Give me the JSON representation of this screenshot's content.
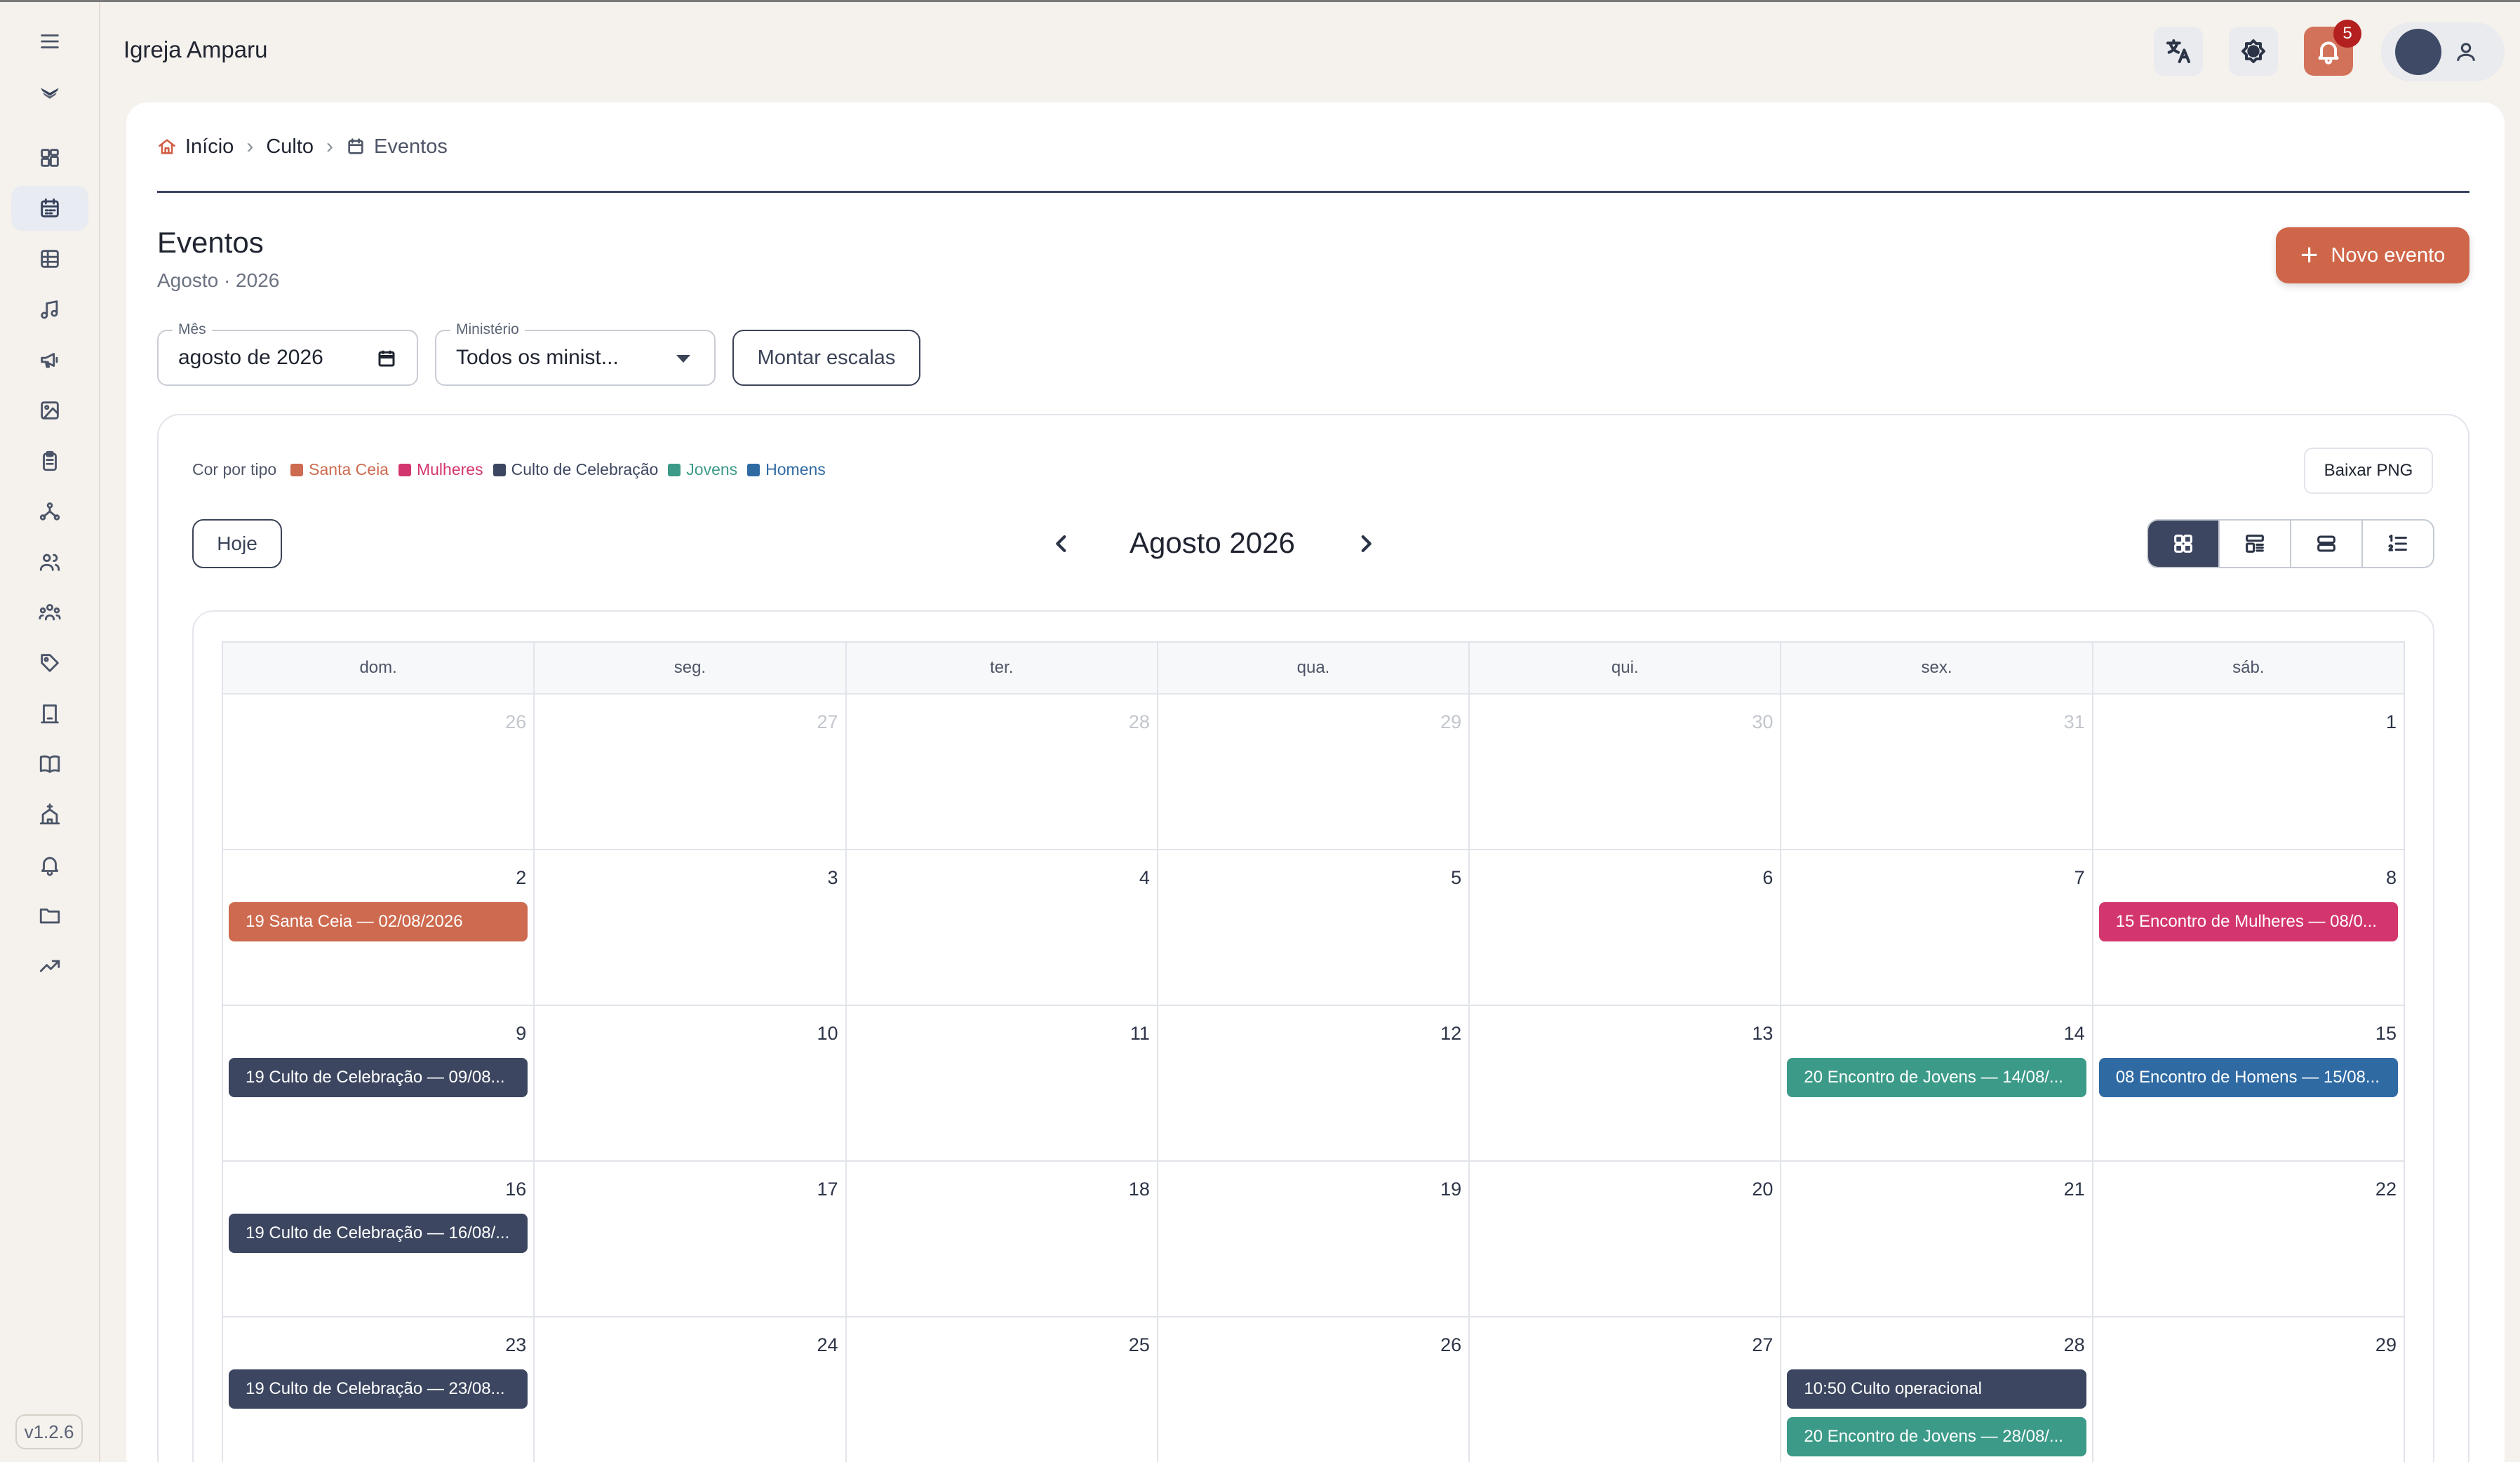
{
  "app": {
    "title": "Igreja Amparu",
    "version": "v1.2.6"
  },
  "topbar": {
    "translate_icon": "translate-icon",
    "theme_icon": "brightness-icon",
    "notifications_count": "5"
  },
  "breadcrumb": {
    "home": "Início",
    "section": "Culto",
    "current": "Eventos"
  },
  "page": {
    "title": "Eventos",
    "subtitle": "Agosto · 2026",
    "new_event_label": "Novo evento"
  },
  "filters": {
    "month_label": "Mês",
    "month_value": "agosto de 2026",
    "ministry_label": "Ministério",
    "ministry_value": "Todos os minist...",
    "build_scales_label": "Montar escalas"
  },
  "legend": {
    "title": "Cor por tipo",
    "items": [
      {
        "label": "Santa Ceia",
        "color": "#cd6a4f"
      },
      {
        "label": "Mulheres",
        "color": "#d3366e"
      },
      {
        "label": "Culto de Celebração",
        "color": "#3c4660"
      },
      {
        "label": "Jovens",
        "color": "#3c9a88"
      },
      {
        "label": "Homens",
        "color": "#2f6aa3"
      }
    ]
  },
  "calendar": {
    "download_label": "Baixar PNG",
    "today_label": "Hoje",
    "month_title": "Agosto 2026",
    "weekdays": [
      "dom.",
      "seg.",
      "ter.",
      "qua.",
      "qui.",
      "sex.",
      "sáb."
    ],
    "weeks": [
      [
        {
          "d": "26",
          "o": true
        },
        {
          "d": "27",
          "o": true
        },
        {
          "d": "28",
          "o": true
        },
        {
          "d": "29",
          "o": true
        },
        {
          "d": "30",
          "o": true
        },
        {
          "d": "31",
          "o": true
        },
        {
          "d": "1"
        }
      ],
      [
        {
          "d": "2",
          "e": [
            {
              "t": "19 Santa Ceia — 02/08/2026",
              "c": "#cd6a4f"
            }
          ]
        },
        {
          "d": "3"
        },
        {
          "d": "4"
        },
        {
          "d": "5"
        },
        {
          "d": "6"
        },
        {
          "d": "7"
        },
        {
          "d": "8",
          "e": [
            {
              "t": "15 Encontro de Mulheres — 08/0...",
              "c": "#d3366e"
            }
          ]
        }
      ],
      [
        {
          "d": "9",
          "e": [
            {
              "t": "19 Culto de Celebração — 09/08...",
              "c": "#3c4660"
            }
          ]
        },
        {
          "d": "10"
        },
        {
          "d": "11"
        },
        {
          "d": "12"
        },
        {
          "d": "13"
        },
        {
          "d": "14",
          "e": [
            {
              "t": "20 Encontro de Jovens — 14/08/...",
              "c": "#3c9a88"
            }
          ]
        },
        {
          "d": "15",
          "e": [
            {
              "t": "08 Encontro de Homens — 15/08...",
              "c": "#2f6aa3"
            }
          ]
        }
      ],
      [
        {
          "d": "16",
          "e": [
            {
              "t": "19 Culto de Celebração — 16/08/...",
              "c": "#3c4660"
            }
          ]
        },
        {
          "d": "17"
        },
        {
          "d": "18"
        },
        {
          "d": "19"
        },
        {
          "d": "20"
        },
        {
          "d": "21"
        },
        {
          "d": "22"
        }
      ],
      [
        {
          "d": "23",
          "e": [
            {
              "t": "19 Culto de Celebração — 23/08...",
              "c": "#3c4660"
            }
          ]
        },
        {
          "d": "24"
        },
        {
          "d": "25"
        },
        {
          "d": "26"
        },
        {
          "d": "27"
        },
        {
          "d": "28",
          "e": [
            {
              "t": "10:50 Culto operacional",
              "c": "#3c4660"
            },
            {
              "t": "20 Encontro de Jovens — 28/08/...",
              "c": "#3c9a88"
            }
          ]
        },
        {
          "d": "29"
        }
      ]
    ]
  }
}
